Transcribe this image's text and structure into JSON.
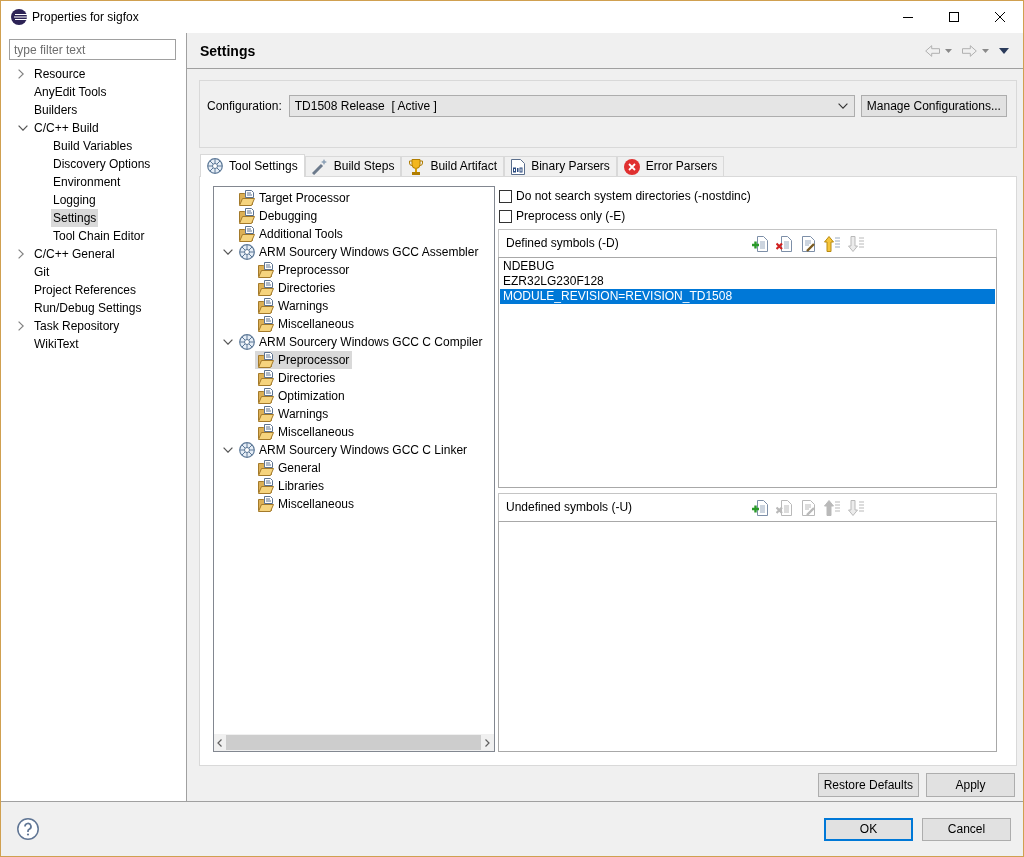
{
  "window": {
    "title": "Properties for sigfox"
  },
  "sidebar": {
    "filter": {
      "placeholder": "type filter text"
    },
    "items": [
      {
        "label": "Resource",
        "expanded": false,
        "selected": false
      },
      {
        "label": "AnyEdit Tools",
        "selected": false
      },
      {
        "label": "Builders",
        "selected": false
      },
      {
        "label": "C/C++ Build",
        "expanded": true,
        "selected": false,
        "children": [
          {
            "label": "Build Variables",
            "selected": false
          },
          {
            "label": "Discovery Options",
            "selected": false
          },
          {
            "label": "Environment",
            "selected": false
          },
          {
            "label": "Logging",
            "selected": false
          },
          {
            "label": "Settings",
            "selected": true
          },
          {
            "label": "Tool Chain Editor",
            "selected": false
          }
        ]
      },
      {
        "label": "C/C++ General",
        "expanded": false,
        "selected": false
      },
      {
        "label": "Git",
        "selected": false
      },
      {
        "label": "Project References",
        "selected": false
      },
      {
        "label": "Run/Debug Settings",
        "selected": false
      },
      {
        "label": "Task Repository",
        "expanded": false,
        "selected": false
      },
      {
        "label": "WikiText",
        "selected": false
      }
    ]
  },
  "page": {
    "title": "Settings"
  },
  "configuration": {
    "label": "Configuration:",
    "value": "TD1508 Release  [ Active ]",
    "button": "Manage Configurations..."
  },
  "tabs": [
    {
      "label": "Tool Settings",
      "selected": true
    },
    {
      "label": "Build Steps",
      "selected": false
    },
    {
      "label": "Build Artifact",
      "selected": false
    },
    {
      "label": "Binary Parsers",
      "selected": false
    },
    {
      "label": "Error Parsers",
      "selected": false
    }
  ],
  "tool_tree": {
    "items": [
      {
        "label": "Target Processor",
        "kind": "option",
        "selected": false
      },
      {
        "label": "Debugging",
        "kind": "option",
        "selected": false
      },
      {
        "label": "Additional Tools",
        "kind": "option",
        "selected": false
      },
      {
        "label": "ARM Sourcery Windows GCC Assembler",
        "kind": "tool",
        "expanded": true,
        "selected": false,
        "children": [
          {
            "label": "Preprocessor",
            "kind": "option",
            "selected": false
          },
          {
            "label": "Directories",
            "kind": "option",
            "selected": false
          },
          {
            "label": "Warnings",
            "kind": "option",
            "selected": false
          },
          {
            "label": "Miscellaneous",
            "kind": "option",
            "selected": false
          }
        ]
      },
      {
        "label": "ARM Sourcery Windows GCC C Compiler",
        "kind": "tool",
        "expanded": true,
        "selected": false,
        "children": [
          {
            "label": "Preprocessor",
            "kind": "option",
            "selected": true
          },
          {
            "label": "Directories",
            "kind": "option",
            "selected": false
          },
          {
            "label": "Optimization",
            "kind": "option",
            "selected": false
          },
          {
            "label": "Warnings",
            "kind": "option",
            "selected": false
          },
          {
            "label": "Miscellaneous",
            "kind": "option",
            "selected": false
          }
        ]
      },
      {
        "label": "ARM Sourcery Windows GCC C Linker",
        "kind": "tool",
        "expanded": true,
        "selected": false,
        "children": [
          {
            "label": "General",
            "kind": "option",
            "selected": false
          },
          {
            "label": "Libraries",
            "kind": "option",
            "selected": false
          },
          {
            "label": "Miscellaneous",
            "kind": "option",
            "selected": false
          }
        ]
      }
    ]
  },
  "options": [
    {
      "label": "Do not search system directories (-nostdinc)",
      "checked": false
    },
    {
      "label": "Preprocess only (-E)",
      "checked": false
    }
  ],
  "symbol_lists": [
    {
      "title": "Defined symbols (-D)",
      "tools": [
        {
          "disabled": false
        },
        {
          "disabled": false
        },
        {
          "disabled": false
        },
        {
          "disabled": false
        },
        {
          "disabled": true
        }
      ],
      "items": [
        {
          "label": "NDEBUG",
          "selected": false
        },
        {
          "label": "EZR32LG230F128",
          "selected": false
        },
        {
          "label": "MODULE_REVISION=REVISION_TD1508",
          "selected": true
        }
      ]
    },
    {
      "title": "Undefined symbols (-U)",
      "tools": [
        {
          "disabled": false
        },
        {
          "disabled": true
        },
        {
          "disabled": true
        },
        {
          "disabled": true
        },
        {
          "disabled": true
        }
      ]
    }
  ],
  "page_buttons": [
    "Restore Defaults",
    "Apply"
  ],
  "dialog_buttons": [
    {
      "label": "OK",
      "default": true
    },
    {
      "label": "Cancel",
      "default": false
    }
  ]
}
